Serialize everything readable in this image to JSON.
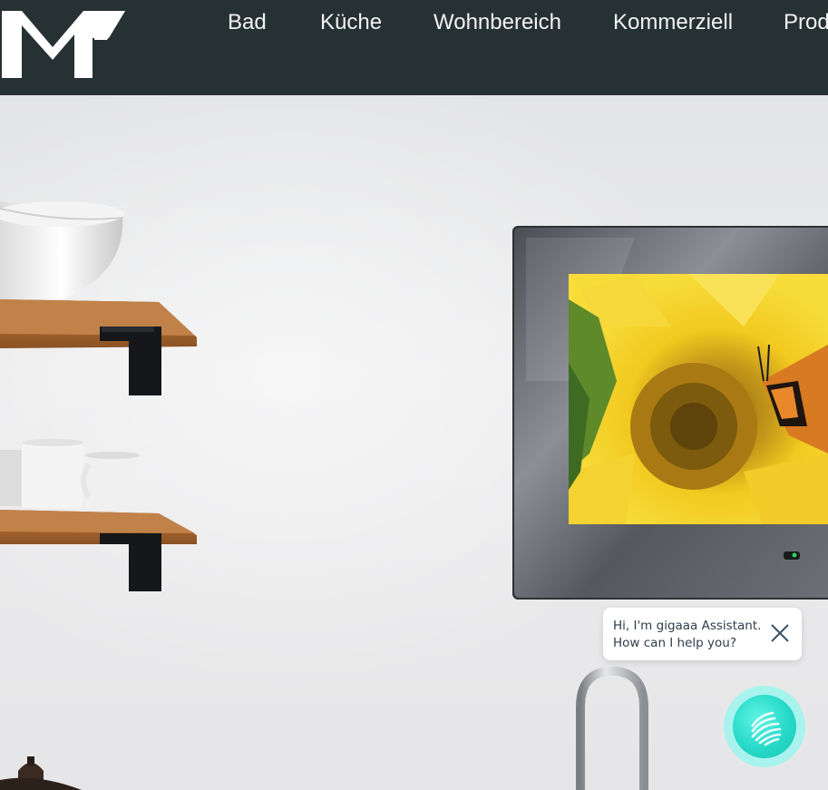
{
  "header": {
    "logo_icon": "mt-logo",
    "nav": [
      {
        "label": "Bad"
      },
      {
        "label": "Küche"
      },
      {
        "label": "Wohnbereich"
      },
      {
        "label": "Kommerziell"
      },
      {
        "label": "Prod"
      }
    ]
  },
  "hero": {
    "image": "kitchen-wall-tv-scene"
  },
  "chat": {
    "greeting_line1": "Hi, I'm gigaaa Assistant.",
    "greeting_line2": "How can I help you?",
    "close_icon": "close-icon",
    "launcher_icon": "gigaaa-assistant-icon"
  },
  "colors": {
    "header_bg": "#263133",
    "nav_text": "#f2f2f2",
    "chat_text": "#2f3d4a",
    "launcher": "#26d9c8"
  }
}
